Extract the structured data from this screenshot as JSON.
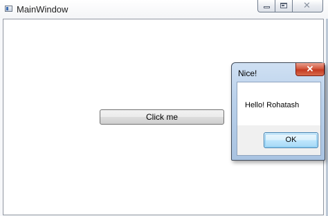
{
  "main_window": {
    "title": "MainWindow",
    "icon": "window-icon",
    "caption_buttons": {
      "minimize": "minimize-icon",
      "maximize": "maximize-icon",
      "close": "close-icon"
    },
    "close_glyph": "✕",
    "button_label": "Click me"
  },
  "dialog": {
    "title": "Nice!",
    "close_glyph": "✕",
    "message": "Hello! Rohatash",
    "ok_label": "OK"
  },
  "colors": {
    "dialog_frame": "#b9d0ea",
    "close_button": "#c43b22",
    "ok_button_border": "#3c7fb1"
  }
}
